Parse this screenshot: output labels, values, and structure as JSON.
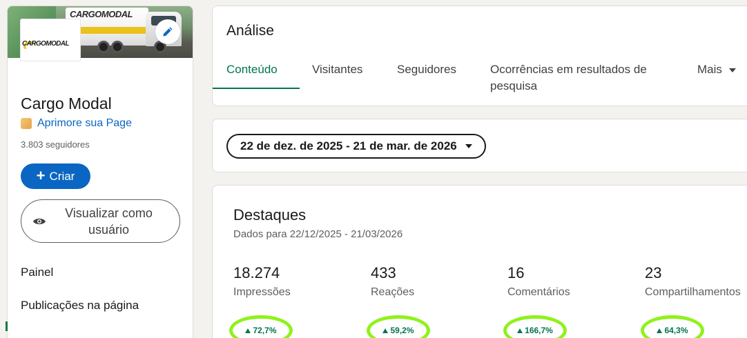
{
  "sidebar": {
    "cover_brand": "CARGOMODAL",
    "logo_text": "CARGOMODAL",
    "company_name": "Cargo Modal",
    "improve_link": "Aprimore sua Page",
    "followers": "3.803 seguidores",
    "create_label": "Criar",
    "create_plus": "+",
    "view_as_user_label": "Visualizar como usuário",
    "nav": [
      "Painel",
      "Publicações na página"
    ]
  },
  "analytics": {
    "title": "Análise",
    "tabs": [
      {
        "label": "Conteúdo",
        "active": true
      },
      {
        "label": "Visitantes"
      },
      {
        "label": "Seguidores"
      },
      {
        "label": "Ocorrências em resultados de pesquisa"
      },
      {
        "label": "Mais"
      }
    ]
  },
  "date_range": {
    "label": "22 de dez. de 2025 - 21 de mar. de 2026"
  },
  "highlights": {
    "title": "Destaques",
    "subtitle": "Dados para 22/12/2025 - 21/03/2026",
    "metrics": [
      {
        "value": "18.274",
        "label": "Impressões",
        "change": "72,7%"
      },
      {
        "value": "433",
        "label": "Reações",
        "change": "59,2%"
      },
      {
        "value": "16",
        "label": "Comentários",
        "change": "166,7%"
      },
      {
        "value": "23",
        "label": "Compartilhamentos",
        "change": "64,3%"
      }
    ]
  },
  "colors": {
    "accent": "#01754f",
    "link": "#0a66c2",
    "highlight_circle": "#8ff21b"
  },
  "icons": [
    "pencil-icon",
    "eye-icon",
    "chevron-down-icon",
    "arrow-up-icon"
  ]
}
